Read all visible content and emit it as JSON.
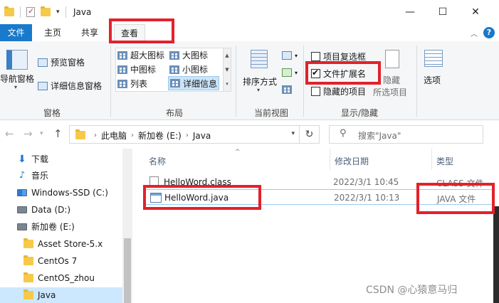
{
  "window": {
    "title": "Java",
    "minimize": "—",
    "maximize": "☐",
    "close": "✕"
  },
  "tabs": {
    "file": "文件",
    "home": "主页",
    "share": "共享",
    "view": "查看"
  },
  "ribbon": {
    "panes": {
      "nav_pane": "导航窗格",
      "preview_pane": "预览窗格",
      "details_pane": "详细信息窗格",
      "group_label": "窗格"
    },
    "layout": {
      "items": [
        "超大图标",
        "大图标",
        "中图标",
        "小图标",
        "列表",
        "详细信息"
      ],
      "selected": "详细信息",
      "group_label": "布局"
    },
    "current_view": {
      "sort_by": "排序方式",
      "group_label": "当前视图"
    },
    "show_hide": {
      "item_checkboxes": {
        "label": "项目复选框",
        "checked": false
      },
      "file_extensions": {
        "label": "文件扩展名",
        "checked": true
      },
      "hidden_items": {
        "label": "隐藏的项目",
        "checked": false
      },
      "hide_line1": "隐藏",
      "hide_line2": "所选项目",
      "group_label": "显示/隐藏"
    },
    "options": "选项"
  },
  "address": {
    "crumbs": [
      "此电脑",
      "新加卷 (E:)",
      "Java"
    ],
    "search_placeholder": "搜索\"Java\""
  },
  "sidebar": {
    "items": [
      "下载",
      "音乐",
      "Windows-SSD (C:)",
      "Data (D:)",
      "新加卷 (E:)",
      "Asset Store-5.x",
      "CentOs 7",
      "CentOS_zhou",
      "Java"
    ],
    "selected": "Java"
  },
  "columns": {
    "name": "名称",
    "date": "修改日期",
    "type": "类型"
  },
  "files": [
    {
      "name": "HelloWord.class",
      "date": "2022/3/1 10:45",
      "type": "CLASS 文件"
    },
    {
      "name": "HelloWord.java",
      "date": "2022/3/1 10:13",
      "type": "JAVA 文件"
    }
  ],
  "watermark": "CSDN @心猿意马归",
  "colors": {
    "accent": "#1979ca",
    "selection": "#cce8ff",
    "highlight_box": "#e3212b"
  }
}
